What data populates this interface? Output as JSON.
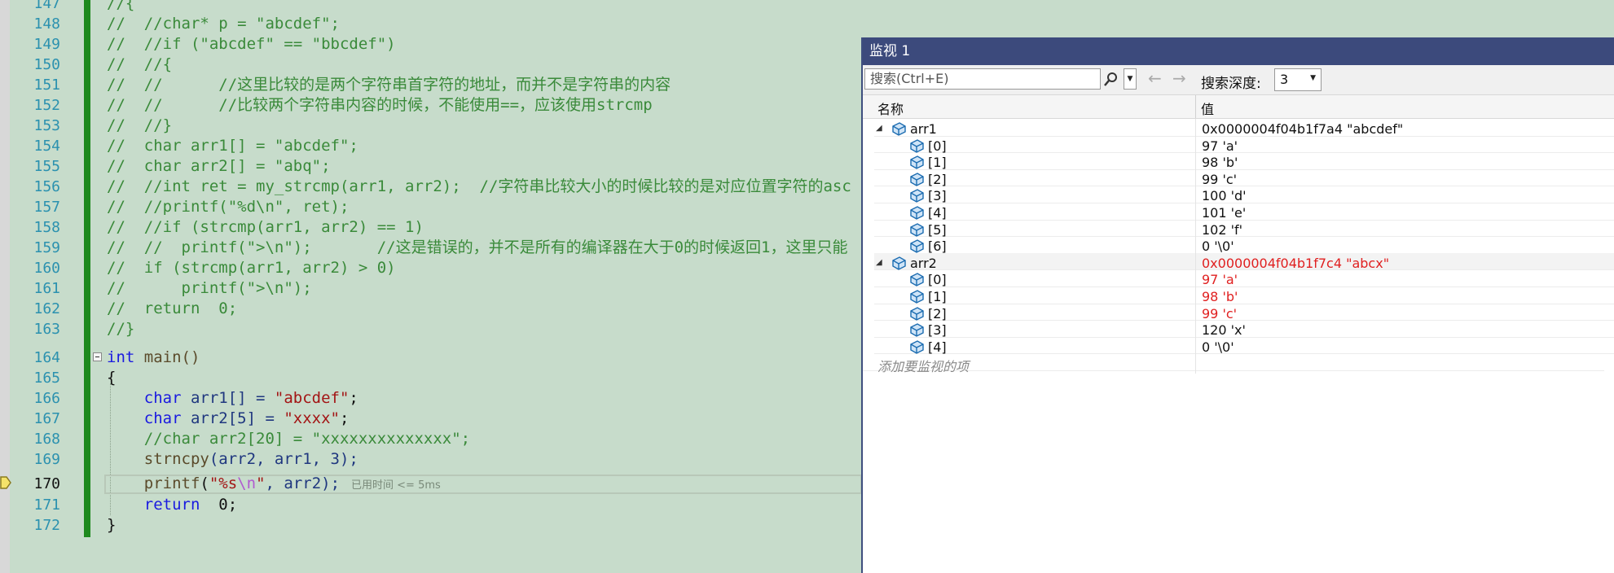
{
  "editor": {
    "lines": [
      {
        "num": "147",
        "code": "//{"
      },
      {
        "num": "148",
        "code": "//  //char* p = \"abcdef\";"
      },
      {
        "num": "149",
        "code": "//  //if (\"abcdef\" == \"bbcdef\")"
      },
      {
        "num": "150",
        "code": "//  //{"
      },
      {
        "num": "151",
        "code": "//  //      //这里比较的是两个字符串首字符的地址，而并不是字符串的内容"
      },
      {
        "num": "152",
        "code": "//  //      //比较两个字符串内容的时候，不能使用==，应该使用strcmp"
      },
      {
        "num": "153",
        "code": "//  //}"
      },
      {
        "num": "154",
        "code": "//  char arr1[] = \"abcdef\";"
      },
      {
        "num": "155",
        "code": "//  char arr2[] = \"abq\";"
      },
      {
        "num": "156",
        "code": "//  //int ret = my_strcmp(arr1, arr2);  //字符串比较大小的时候比较的是对应位置字符的asc"
      },
      {
        "num": "157",
        "code": "//  //printf(\"%d\\n\", ret);"
      },
      {
        "num": "158",
        "code": "//  //if (strcmp(arr1, arr2) == 1)"
      },
      {
        "num": "159",
        "code": "//  //  printf(\">\\n\");       //这是错误的，并不是所有的编译器在大于0的时候返回1，这里只能"
      },
      {
        "num": "160",
        "code": "//  if (strcmp(arr1, arr2) > 0)"
      },
      {
        "num": "161",
        "code": "//      printf(\">\\n\");"
      },
      {
        "num": "162",
        "code": "//  return  0;"
      },
      {
        "num": "163",
        "code": "//}"
      },
      {
        "num": "164"
      },
      {
        "num": "165",
        "code": "{"
      },
      {
        "num": "166"
      },
      {
        "num": "167"
      },
      {
        "num": "168",
        "code": "    //char arr2[20] = \"xxxxxxxxxxxxxx\";"
      },
      {
        "num": "169"
      },
      {
        "num": "170"
      },
      {
        "num": "171"
      },
      {
        "num": "172",
        "code": "}"
      }
    ],
    "tokens": {
      "l164_int": "int",
      "l164_main": " main()",
      "l166_char": "    char",
      "l166_rest": " arr1[] = ",
      "l166_str": "\"abcdef\"",
      "l166_end": ";",
      "l167_char": "    char",
      "l167_rest": " arr2[5] = ",
      "l167_str": "\"xxxx\"",
      "l167_end": ";",
      "l169_fn": "    strncpy",
      "l169_rest": "(arr2, arr1, 3);",
      "l170_fn": "    printf",
      "l170_open": "(",
      "l170_str1": "\"%s",
      "l170_esc": "\\n",
      "l170_str2": "\"",
      "l170_rest": ", arr2);",
      "l170_hint": "已用时间 <= 5ms",
      "l171_kw": "    return",
      "l171_rest": "  0;"
    }
  },
  "watch": {
    "title": "监视 1",
    "search_placeholder": "搜索(Ctrl+E)",
    "back_label": "←",
    "forward_label": "→",
    "depth_label": "搜索深度:",
    "depth_value": "3",
    "header_name": "名称",
    "header_value": "值",
    "add_item_label": "添加要监视的项",
    "changed_color": "#e02020",
    "rows": [
      {
        "name": "arr1",
        "value": "0x0000004f04b1f7a4 \"abcdef\"",
        "level": 0,
        "expanded": true,
        "changed": false
      },
      {
        "name": "[0]",
        "value": "97 'a'",
        "level": 1,
        "changed": false
      },
      {
        "name": "[1]",
        "value": "98 'b'",
        "level": 1,
        "changed": false
      },
      {
        "name": "[2]",
        "value": "99 'c'",
        "level": 1,
        "changed": false
      },
      {
        "name": "[3]",
        "value": "100 'd'",
        "level": 1,
        "changed": false
      },
      {
        "name": "[4]",
        "value": "101 'e'",
        "level": 1,
        "changed": false
      },
      {
        "name": "[5]",
        "value": "102 'f'",
        "level": 1,
        "changed": false
      },
      {
        "name": "[6]",
        "value": "0 '\\0'",
        "level": 1,
        "changed": false
      },
      {
        "name": "arr2",
        "value": "0x0000004f04b1f7c4 \"abcx\"",
        "level": 0,
        "expanded": true,
        "changed": true
      },
      {
        "name": "[0]",
        "value": "97 'a'",
        "level": 1,
        "changed": true
      },
      {
        "name": "[1]",
        "value": "98 'b'",
        "level": 1,
        "changed": true
      },
      {
        "name": "[2]",
        "value": "99 'c'",
        "level": 1,
        "changed": true
      },
      {
        "name": "[3]",
        "value": "120 'x'",
        "level": 1,
        "changed": false
      },
      {
        "name": "[4]",
        "value": "0 '\\0'",
        "level": 1,
        "changed": false
      }
    ]
  }
}
